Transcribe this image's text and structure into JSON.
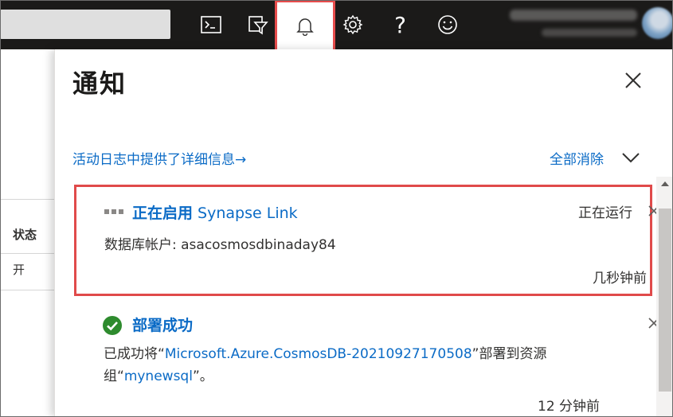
{
  "topbar": {
    "icons": [
      "cloud-shell-icon",
      "directory-filter-icon",
      "notifications-bell-icon",
      "settings-gear-icon",
      "help-icon",
      "feedback-smiley-icon"
    ],
    "help_glyph": "?",
    "active_icon": "notifications-bell-icon"
  },
  "background_page": {
    "column_header": "状态",
    "cell_value": "开"
  },
  "notifications": {
    "title": "通知",
    "activity_log_link": "活动日志中提供了详细信息",
    "activity_log_arrow": "→",
    "dismiss_all": "全部消除",
    "items": [
      {
        "title_bold": "正在启用",
        "title_rest": " Synapse Link",
        "status": "正在运行",
        "body": "数据库帐户: asacosmosdbinaday84",
        "time": "几秒钟前",
        "icon": "progress-dots-icon"
      },
      {
        "title": "部署成功",
        "body_prefix": "已成功将“",
        "body_link1": "Microsoft.Azure.CosmosDB-20210927170508",
        "body_mid": "”部署到资源组“",
        "body_link2": "mynewsql",
        "body_suffix": "”。",
        "time": "12 分钟前",
        "icon": "success-check-icon"
      }
    ]
  },
  "colors": {
    "link": "#0b6bc6",
    "highlight": "#e04a4a",
    "success": "#2e8b2e",
    "topbar": "#1b1a19"
  }
}
